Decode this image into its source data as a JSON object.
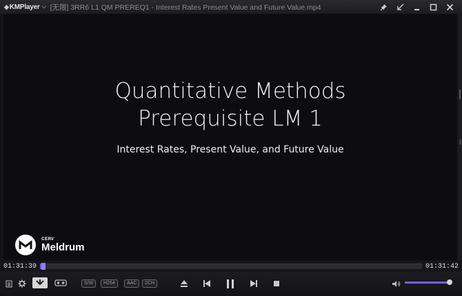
{
  "app": {
    "name": "KMPlayer",
    "title": "[无限] 3RR6 L1 QM PREREQ1 - Interest Rates Present Value and Future Value.mp4"
  },
  "slide": {
    "title_line1": "Quantitative Methods",
    "title_line2": "Prerequisite LM 1",
    "subtitle": "Interest Rates, Present Value, and Future Value",
    "brand_top": "CERI⁄",
    "brand_name": "Meldrum"
  },
  "playback": {
    "current_time": "01:31:39",
    "total_time": "01:31:42",
    "progress": 0.004,
    "volume": 0.98
  },
  "badges": {
    "sw": "S/W",
    "h264": "H264",
    "aac": "AAC",
    "channels": "2CH"
  },
  "icons": {
    "logo": "km-logo-icon",
    "dropdown": "chevron-down-icon",
    "pin": "pin-icon",
    "minimize_to_mini": "shrink-icon",
    "minimize": "minimize-icon",
    "maximize": "maximize-icon",
    "close": "close-icon",
    "playlist": "playlist-icon",
    "settings": "gear-icon",
    "capture": "capture-icon",
    "vr": "vr-glasses-icon",
    "eject": "eject-icon",
    "prev": "skip-back-icon",
    "pause": "pause-icon",
    "next": "skip-forward-icon",
    "stop": "stop-icon",
    "volume": "speaker-icon"
  },
  "colors": {
    "accent": "#6c5ce7",
    "volume_accent": "#7c5cf2"
  }
}
